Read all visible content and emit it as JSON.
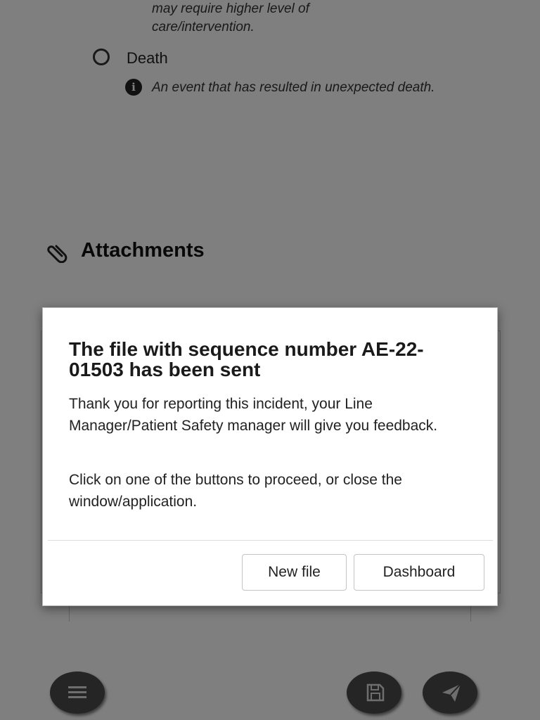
{
  "background": {
    "previous_option": {
      "description": "may require higher level of care/intervention."
    },
    "death_option": {
      "label": "Death",
      "description": "An event that has resulted in unexpected death."
    },
    "attachments": {
      "title": "Attachments"
    },
    "fabs": {
      "menu_icon": "hamburger-menu",
      "save_icon": "floppy-disk",
      "send_icon": "paper-plane"
    }
  },
  "dialog": {
    "title": "The file with sequence number AE-22-01503 has been sent",
    "message_1": "Thank you for reporting this incident, your Line Manager/Patient Safety manager will give you feedback.",
    "message_2": "Click on one of the buttons to proceed, or close the window/application.",
    "new_file_label": "New file",
    "dashboard_label": "Dashboard"
  },
  "colors": {
    "overlay": "#000000",
    "dialog_background": "#ffffff",
    "fab_background": "#4a4a4a"
  }
}
